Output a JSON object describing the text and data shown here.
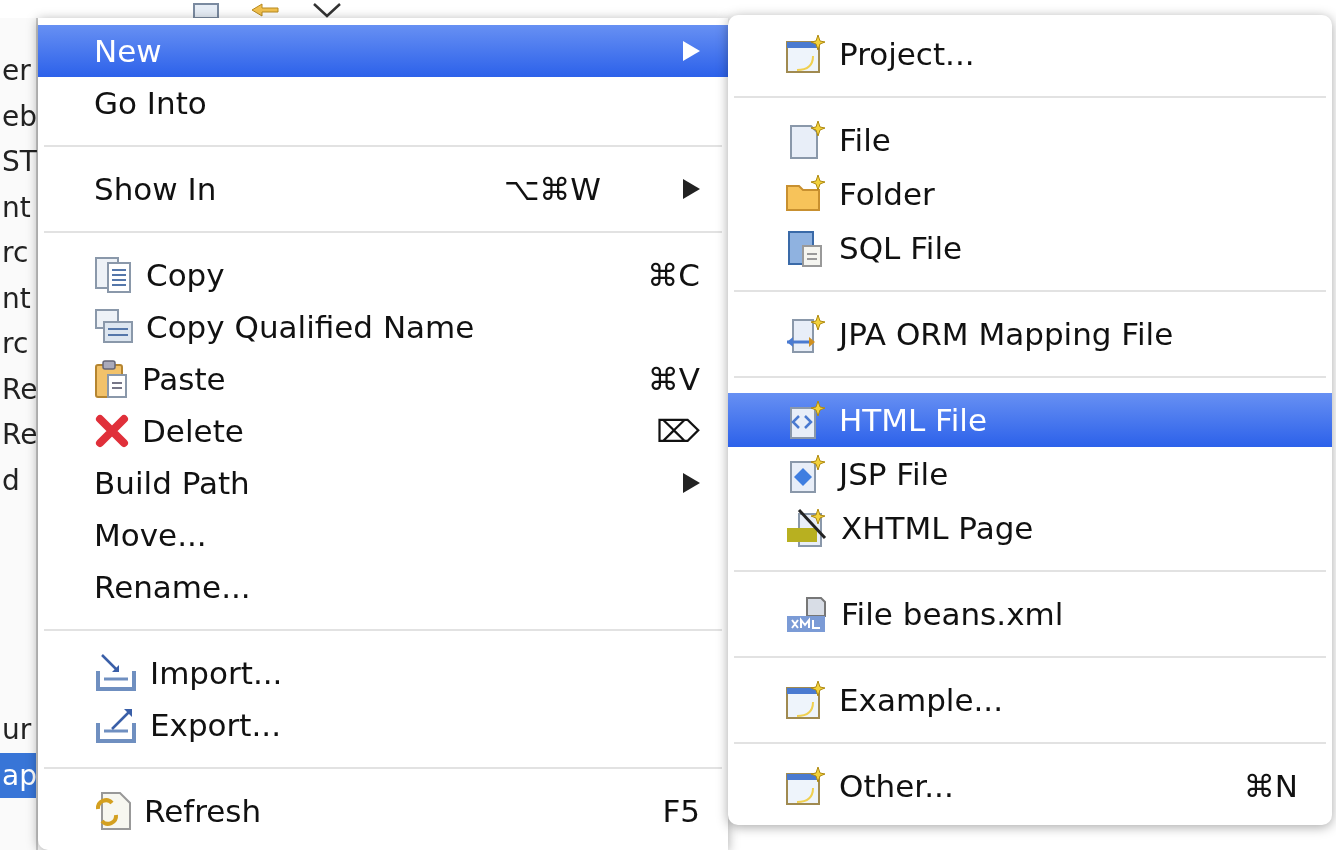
{
  "explorer_tree": {
    "upper_items": [
      {
        "label": "er",
        "selected": false
      },
      {
        "label": "eb",
        "selected": false
      },
      {
        "label": "ST",
        "selected": false
      },
      {
        "label": "nt",
        "selected": false
      },
      {
        "label": "rc",
        "selected": false
      },
      {
        "label": "nt",
        "selected": false
      },
      {
        "label": "rc",
        "selected": false
      },
      {
        "label": "Re",
        "selected": false
      },
      {
        "label": "Re",
        "selected": false
      },
      {
        "label": "d",
        "selected": false
      }
    ],
    "lower_items": [
      {
        "label": "ur",
        "selected": false
      },
      {
        "label": "ap",
        "selected": true
      }
    ]
  },
  "context_menu": {
    "groups": [
      {
        "items": [
          {
            "label": "New",
            "selected": true,
            "has_submenu": true
          },
          {
            "label": "Go Into",
            "selected": false,
            "has_submenu": false
          }
        ]
      },
      {
        "items": [
          {
            "label": "Show In",
            "shortcut": "⌥⌘W",
            "selected": false,
            "has_submenu": true
          }
        ]
      },
      {
        "items": [
          {
            "label": "Copy",
            "shortcut": "⌘C",
            "selected": false,
            "has_submenu": false
          },
          {
            "label": "Copy Qualified Name",
            "selected": false,
            "has_submenu": false
          },
          {
            "label": "Paste",
            "shortcut": "⌘V",
            "selected": false,
            "has_submenu": false
          },
          {
            "label": "Delete",
            "shortcut": "⌦",
            "selected": false,
            "has_submenu": false
          },
          {
            "label": "Build Path",
            "selected": false,
            "has_submenu": true
          },
          {
            "label": "Move...",
            "selected": false,
            "has_submenu": false
          },
          {
            "label": "Rename...",
            "selected": false,
            "has_submenu": false
          }
        ]
      },
      {
        "items": [
          {
            "label": "Import...",
            "selected": false,
            "has_submenu": false
          },
          {
            "label": "Export...",
            "selected": false,
            "has_submenu": false
          }
        ]
      },
      {
        "items": [
          {
            "label": "Refresh",
            "shortcut": "F5",
            "selected": false,
            "has_submenu": false
          }
        ]
      }
    ]
  },
  "new_submenu": {
    "groups": [
      {
        "items": [
          {
            "label": "Project...",
            "selected": false
          }
        ]
      },
      {
        "items": [
          {
            "label": "File",
            "selected": false
          },
          {
            "label": "Folder",
            "selected": false
          },
          {
            "label": "SQL File",
            "selected": false
          }
        ]
      },
      {
        "items": [
          {
            "label": "JPA ORM Mapping File",
            "selected": false
          }
        ]
      },
      {
        "items": [
          {
            "label": "HTML File",
            "selected": true
          },
          {
            "label": "JSP File",
            "selected": false
          },
          {
            "label": "XHTML Page",
            "selected": false
          }
        ]
      },
      {
        "items": [
          {
            "label": "File beans.xml",
            "selected": false
          }
        ]
      },
      {
        "items": [
          {
            "label": "Example...",
            "selected": false
          }
        ]
      },
      {
        "items": [
          {
            "label": "Other...",
            "shortcut": "⌘N",
            "selected": false
          }
        ]
      }
    ]
  }
}
